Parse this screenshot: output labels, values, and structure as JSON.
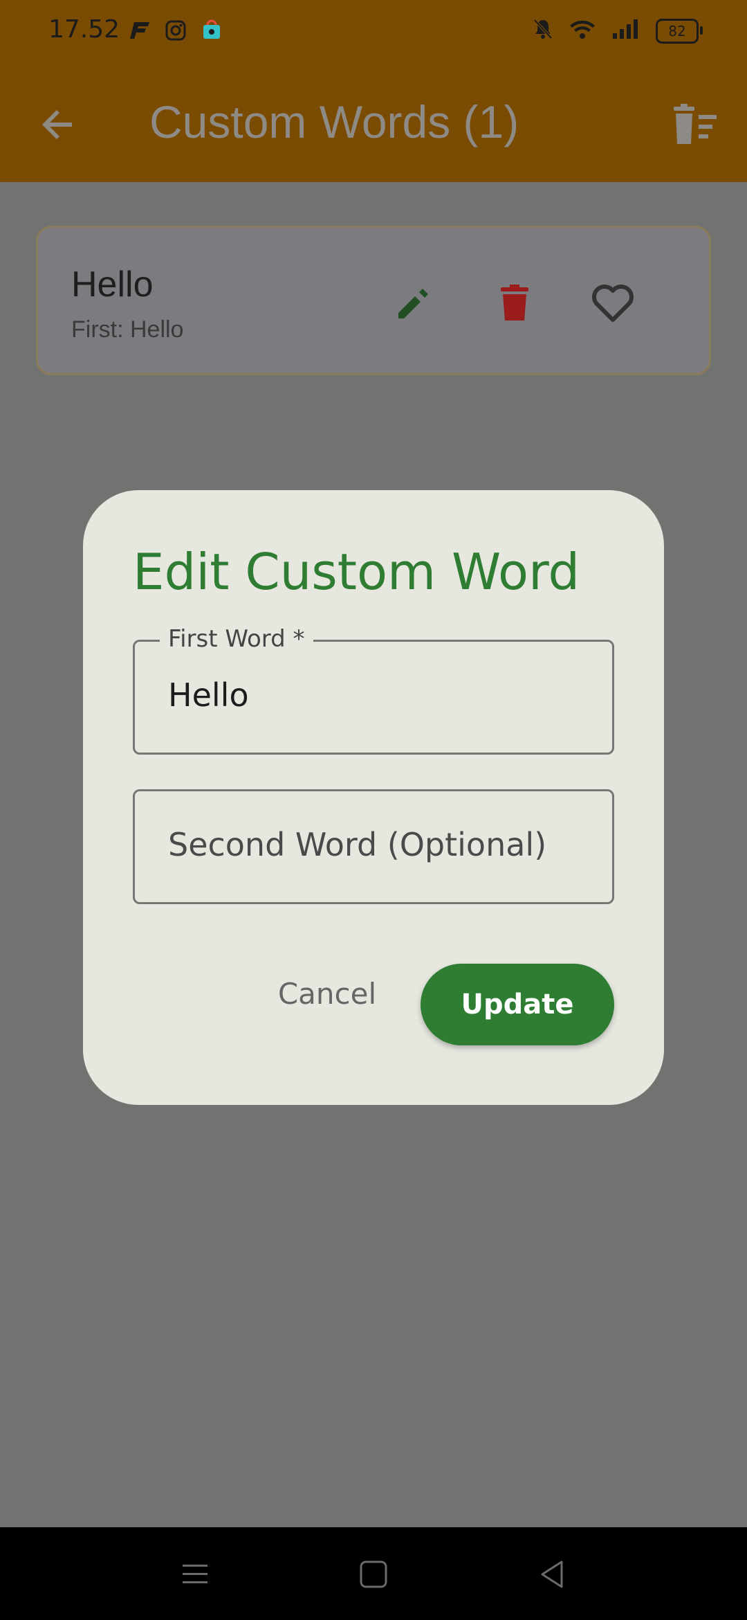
{
  "status_bar": {
    "time": "17.52",
    "battery": "82",
    "icons_left": [
      "app-f-icon",
      "instagram-icon",
      "shop-icon"
    ],
    "icons_right": [
      "mute-bell-icon",
      "wifi-icon",
      "signal-icon",
      "battery-icon"
    ]
  },
  "app_bar": {
    "title": "Custom Words (1)",
    "back_icon": "arrow-left-icon",
    "delete_all_icon": "delete-sweep-icon"
  },
  "word_list": [
    {
      "word": "Hello",
      "subtitle": "First: Hello",
      "actions": [
        "edit-icon",
        "delete-icon",
        "favorite-outline-icon"
      ]
    }
  ],
  "dialog": {
    "title": "Edit Custom Word",
    "first_word": {
      "label": "First Word *",
      "value": "Hello"
    },
    "second_word": {
      "placeholder": "Second Word (Optional)",
      "value": ""
    },
    "cancel_label": "Cancel",
    "update_label": "Update"
  },
  "colors": {
    "app_bar": "#7a4c03",
    "scrim": "#707370",
    "accent_green": "#2e7d32",
    "delete_red": "#9b1c1c",
    "dialog_bg": "#e6e8e0"
  },
  "nav_bar": {
    "buttons": [
      "menu-icon",
      "home-square-icon",
      "back-triangle-icon"
    ]
  }
}
